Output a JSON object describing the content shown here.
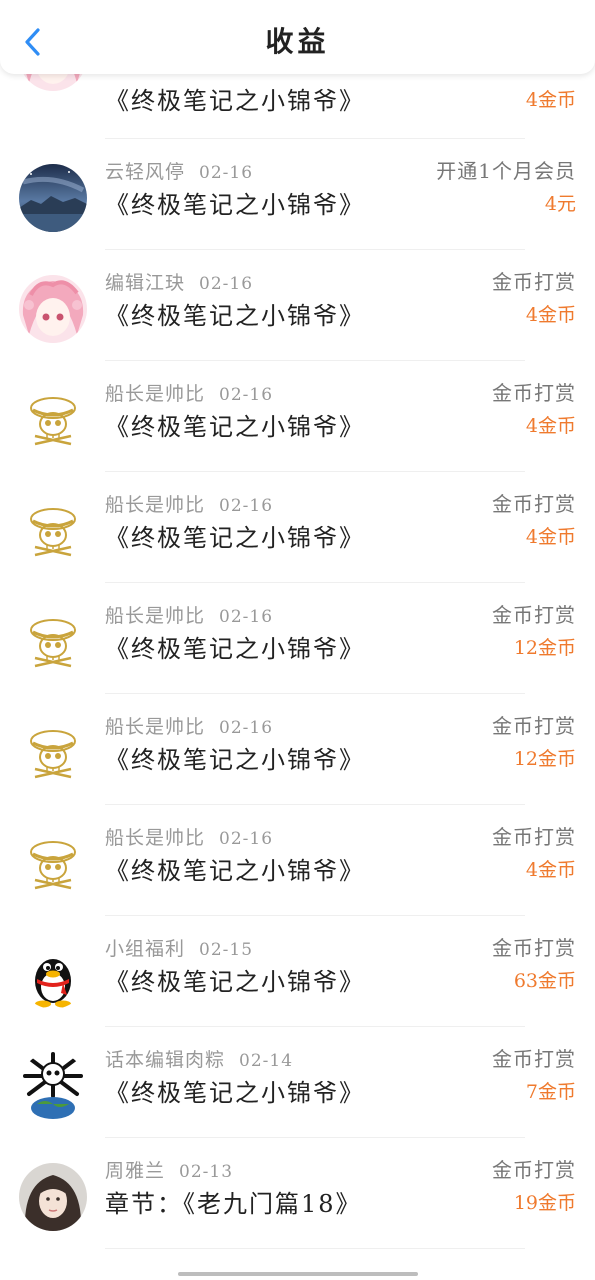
{
  "header": {
    "title": "收益"
  },
  "colors": {
    "accent": "#2f8df5",
    "amount": "#ef7a2e"
  },
  "items": [
    {
      "user": "",
      "date": "",
      "book": "《终极笔记之小锦爷》",
      "type": "",
      "amount": "4金币",
      "avatar": "pink-anime"
    },
    {
      "user": "云轻风停",
      "date": "02-16",
      "book": "《终极笔记之小锦爷》",
      "type": "开通1个月会员",
      "amount": "4元",
      "avatar": "night-sky"
    },
    {
      "user": "编辑江玦",
      "date": "02-16",
      "book": "《终极笔记之小锦爷》",
      "type": "金币打赏",
      "amount": "4金币",
      "avatar": "pink-anime"
    },
    {
      "user": "船长是帅比",
      "date": "02-16",
      "book": "《终极笔记之小锦爷》",
      "type": "金币打赏",
      "amount": "4金币",
      "avatar": "gold-skull"
    },
    {
      "user": "船长是帅比",
      "date": "02-16",
      "book": "《终极笔记之小锦爷》",
      "type": "金币打赏",
      "amount": "4金币",
      "avatar": "gold-skull"
    },
    {
      "user": "船长是帅比",
      "date": "02-16",
      "book": "《终极笔记之小锦爷》",
      "type": "金币打赏",
      "amount": "12金币",
      "avatar": "gold-skull"
    },
    {
      "user": "船长是帅比",
      "date": "02-16",
      "book": "《终极笔记之小锦爷》",
      "type": "金币打赏",
      "amount": "12金币",
      "avatar": "gold-skull"
    },
    {
      "user": "船长是帅比",
      "date": "02-16",
      "book": "《终极笔记之小锦爷》",
      "type": "金币打赏",
      "amount": "4金币",
      "avatar": "gold-skull"
    },
    {
      "user": "小组福利",
      "date": "02-15",
      "book": "《终极笔记之小锦爷》",
      "type": "金币打赏",
      "amount": "63金币",
      "avatar": "qq-penguin"
    },
    {
      "user": "话本编辑肉粽",
      "date": "02-14",
      "book": "《终极笔记之小锦爷》",
      "type": "金币打赏",
      "amount": "7金币",
      "avatar": "globe-skull"
    },
    {
      "user": "周雅兰",
      "date": "02-13",
      "book": "章节：《老九门篇18》",
      "type": "金币打赏",
      "amount": "19金币",
      "avatar": "portrait"
    }
  ]
}
